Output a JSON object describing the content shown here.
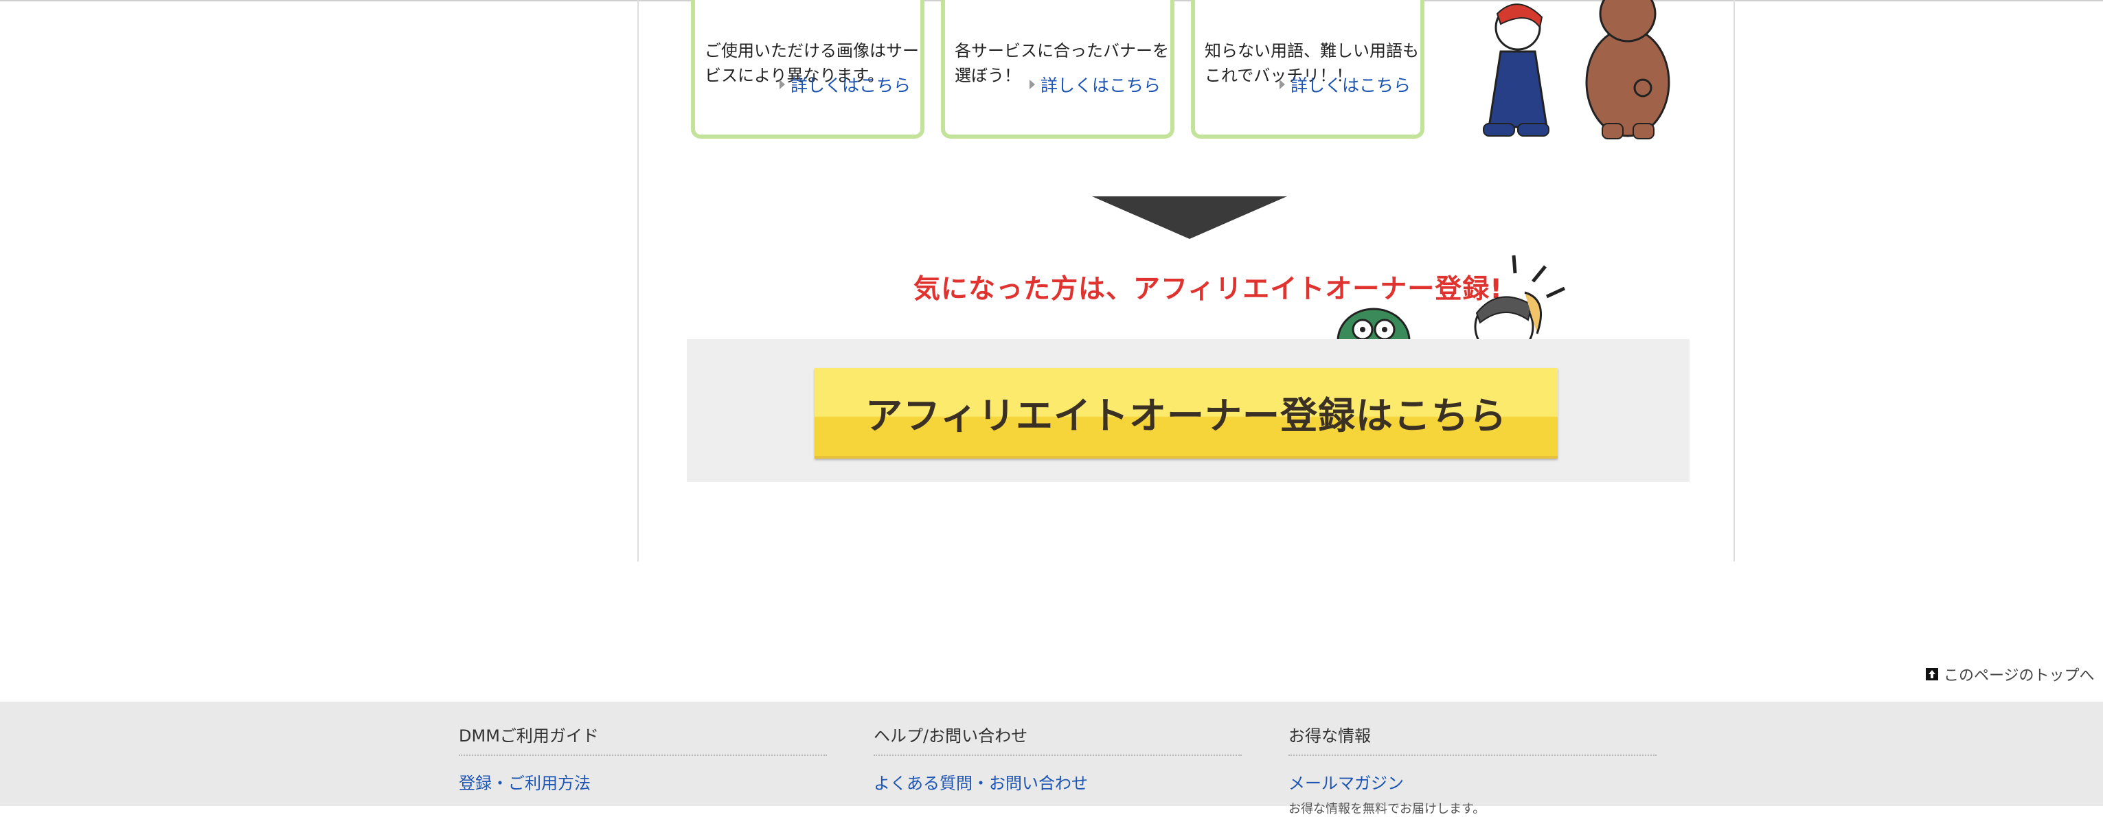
{
  "cards": [
    {
      "text": "ご使用いただける画像はサービスにより異なります。",
      "more": "詳しくはこちら"
    },
    {
      "text": "各サービスに合ったバナーを選ぼう！",
      "more": "詳しくはこちら"
    },
    {
      "text": "知らない用語、難しい用語もこれでバッチリ！！",
      "more": "詳しくはこちら"
    }
  ],
  "cta": {
    "headline": "気になった方は、アフィリエイトオーナー登録!",
    "button_label": "アフィリエイトオーナー登録はこちら"
  },
  "page_top": {
    "label": "このページのトップへ"
  },
  "footer": {
    "columns": [
      {
        "title": "DMMご利用ガイド",
        "links": [
          "登録・ご利用方法"
        ]
      },
      {
        "title": "ヘルプ/お問い合わせ",
        "links": [
          "よくある質問・お問い合わせ"
        ]
      },
      {
        "title": "お得な情報",
        "links": [
          "メールマガジン"
        ],
        "note": "お得な情報を無料でお届けします。"
      }
    ]
  },
  "colors": {
    "accent_link": "#1c55b4",
    "card_border": "#c3e39a",
    "cta_red": "#e0322e",
    "cta_yellow": "#fbea6c"
  },
  "icons": [
    "chevron-right-icon",
    "arrow-down-icon",
    "page-top-icon"
  ]
}
